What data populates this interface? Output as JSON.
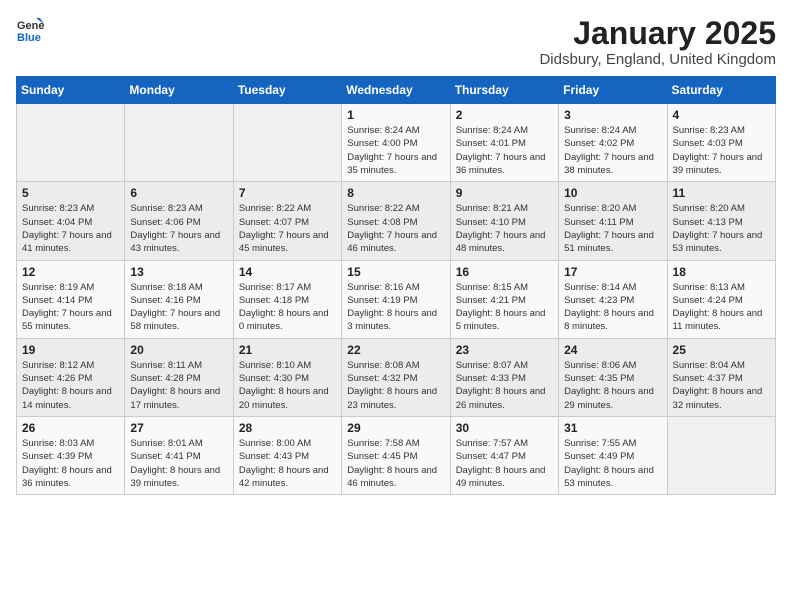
{
  "header": {
    "logo_general": "General",
    "logo_blue": "Blue",
    "month_title": "January 2025",
    "location": "Didsbury, England, United Kingdom"
  },
  "days_of_week": [
    "Sunday",
    "Monday",
    "Tuesday",
    "Wednesday",
    "Thursday",
    "Friday",
    "Saturday"
  ],
  "weeks": [
    {
      "days": [
        {
          "number": "",
          "info": ""
        },
        {
          "number": "",
          "info": ""
        },
        {
          "number": "",
          "info": ""
        },
        {
          "number": "1",
          "info": "Sunrise: 8:24 AM\nSunset: 4:00 PM\nDaylight: 7 hours and 35 minutes."
        },
        {
          "number": "2",
          "info": "Sunrise: 8:24 AM\nSunset: 4:01 PM\nDaylight: 7 hours and 36 minutes."
        },
        {
          "number": "3",
          "info": "Sunrise: 8:24 AM\nSunset: 4:02 PM\nDaylight: 7 hours and 38 minutes."
        },
        {
          "number": "4",
          "info": "Sunrise: 8:23 AM\nSunset: 4:03 PM\nDaylight: 7 hours and 39 minutes."
        }
      ]
    },
    {
      "days": [
        {
          "number": "5",
          "info": "Sunrise: 8:23 AM\nSunset: 4:04 PM\nDaylight: 7 hours and 41 minutes."
        },
        {
          "number": "6",
          "info": "Sunrise: 8:23 AM\nSunset: 4:06 PM\nDaylight: 7 hours and 43 minutes."
        },
        {
          "number": "7",
          "info": "Sunrise: 8:22 AM\nSunset: 4:07 PM\nDaylight: 7 hours and 45 minutes."
        },
        {
          "number": "8",
          "info": "Sunrise: 8:22 AM\nSunset: 4:08 PM\nDaylight: 7 hours and 46 minutes."
        },
        {
          "number": "9",
          "info": "Sunrise: 8:21 AM\nSunset: 4:10 PM\nDaylight: 7 hours and 48 minutes."
        },
        {
          "number": "10",
          "info": "Sunrise: 8:20 AM\nSunset: 4:11 PM\nDaylight: 7 hours and 51 minutes."
        },
        {
          "number": "11",
          "info": "Sunrise: 8:20 AM\nSunset: 4:13 PM\nDaylight: 7 hours and 53 minutes."
        }
      ]
    },
    {
      "days": [
        {
          "number": "12",
          "info": "Sunrise: 8:19 AM\nSunset: 4:14 PM\nDaylight: 7 hours and 55 minutes."
        },
        {
          "number": "13",
          "info": "Sunrise: 8:18 AM\nSunset: 4:16 PM\nDaylight: 7 hours and 58 minutes."
        },
        {
          "number": "14",
          "info": "Sunrise: 8:17 AM\nSunset: 4:18 PM\nDaylight: 8 hours and 0 minutes."
        },
        {
          "number": "15",
          "info": "Sunrise: 8:16 AM\nSunset: 4:19 PM\nDaylight: 8 hours and 3 minutes."
        },
        {
          "number": "16",
          "info": "Sunrise: 8:15 AM\nSunset: 4:21 PM\nDaylight: 8 hours and 5 minutes."
        },
        {
          "number": "17",
          "info": "Sunrise: 8:14 AM\nSunset: 4:23 PM\nDaylight: 8 hours and 8 minutes."
        },
        {
          "number": "18",
          "info": "Sunrise: 8:13 AM\nSunset: 4:24 PM\nDaylight: 8 hours and 11 minutes."
        }
      ]
    },
    {
      "days": [
        {
          "number": "19",
          "info": "Sunrise: 8:12 AM\nSunset: 4:26 PM\nDaylight: 8 hours and 14 minutes."
        },
        {
          "number": "20",
          "info": "Sunrise: 8:11 AM\nSunset: 4:28 PM\nDaylight: 8 hours and 17 minutes."
        },
        {
          "number": "21",
          "info": "Sunrise: 8:10 AM\nSunset: 4:30 PM\nDaylight: 8 hours and 20 minutes."
        },
        {
          "number": "22",
          "info": "Sunrise: 8:08 AM\nSunset: 4:32 PM\nDaylight: 8 hours and 23 minutes."
        },
        {
          "number": "23",
          "info": "Sunrise: 8:07 AM\nSunset: 4:33 PM\nDaylight: 8 hours and 26 minutes."
        },
        {
          "number": "24",
          "info": "Sunrise: 8:06 AM\nSunset: 4:35 PM\nDaylight: 8 hours and 29 minutes."
        },
        {
          "number": "25",
          "info": "Sunrise: 8:04 AM\nSunset: 4:37 PM\nDaylight: 8 hours and 32 minutes."
        }
      ]
    },
    {
      "days": [
        {
          "number": "26",
          "info": "Sunrise: 8:03 AM\nSunset: 4:39 PM\nDaylight: 8 hours and 36 minutes."
        },
        {
          "number": "27",
          "info": "Sunrise: 8:01 AM\nSunset: 4:41 PM\nDaylight: 8 hours and 39 minutes."
        },
        {
          "number": "28",
          "info": "Sunrise: 8:00 AM\nSunset: 4:43 PM\nDaylight: 8 hours and 42 minutes."
        },
        {
          "number": "29",
          "info": "Sunrise: 7:58 AM\nSunset: 4:45 PM\nDaylight: 8 hours and 46 minutes."
        },
        {
          "number": "30",
          "info": "Sunrise: 7:57 AM\nSunset: 4:47 PM\nDaylight: 8 hours and 49 minutes."
        },
        {
          "number": "31",
          "info": "Sunrise: 7:55 AM\nSunset: 4:49 PM\nDaylight: 8 hours and 53 minutes."
        },
        {
          "number": "",
          "info": ""
        }
      ]
    }
  ]
}
